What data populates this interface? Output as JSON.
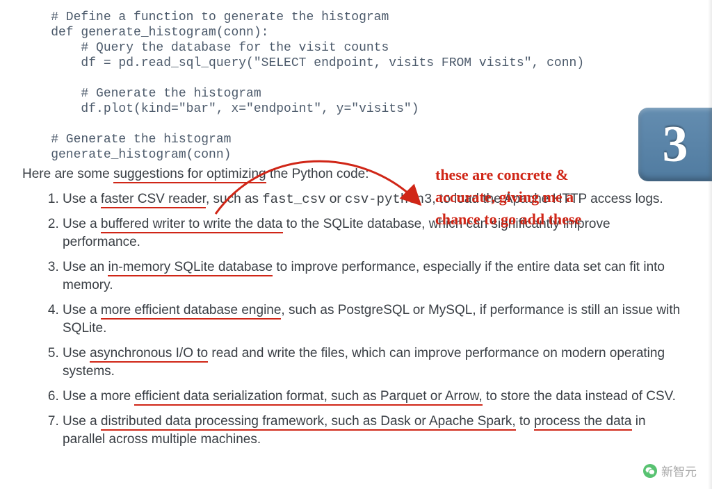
{
  "code": {
    "l1": "    # Define a function to generate the histogram",
    "l2": "    def generate_histogram(conn):",
    "l3": "        # Query the database for the visit counts",
    "l4": "        df = pd.read_sql_query(\"SELECT endpoint, visits FROM visits\", conn)",
    "l5": "",
    "l6": "        # Generate the histogram",
    "l7": "        df.plot(kind=\"bar\", x=\"endpoint\", y=\"visits\")",
    "l8": "",
    "l9": "    # Generate the histogram",
    "l10": "    generate_histogram(conn)"
  },
  "intro": {
    "p1": "Here are some ",
    "u1": "suggestions for optimizing",
    "p2": " the Python code:"
  },
  "annotation": {
    "l1": "these are concrete &",
    "l2": "accurate, giving me a",
    "l3": "chance to go add these"
  },
  "badge": {
    "number": "3"
  },
  "items": {
    "i1": {
      "a": "Use a ",
      "u1": "faster CSV reader",
      "b": ", such as ",
      "m1": "fast_csv",
      "c": " or ",
      "m2": "csv-python3",
      "d": ", to load the Apache HTTP access logs."
    },
    "i2": {
      "a": "Use a ",
      "u1": "buffered writer to write the data",
      "b": " to the SQLite database, which can significantly improve performance."
    },
    "i3": {
      "a": "Use an ",
      "u1": "in-memory SQLite database",
      "b": " to improve performance, especially if the entire data set can fit into memory."
    },
    "i4": {
      "a": "Use a ",
      "u1": "more efficient database engine",
      "b": ", such as PostgreSQL or MySQL, if performance is still an issue with SQLite."
    },
    "i5": {
      "a": "Use ",
      "u1": "asynchronous I/O to",
      "b": " read and write the files, which can improve performance on modern operating systems."
    },
    "i6": {
      "a": "Use a more ",
      "u1": "efficient data serialization format, such as Parquet or Arrow,",
      "b": " to store the data instead of CSV."
    },
    "i7": {
      "a": "Use a ",
      "u1": "distributed data processing framework, such as Dask or Apache Spark,",
      "b": " to ",
      "u2": "process the data",
      "c": " in parallel across multiple machines."
    }
  },
  "watermark": {
    "text": "新智元"
  }
}
